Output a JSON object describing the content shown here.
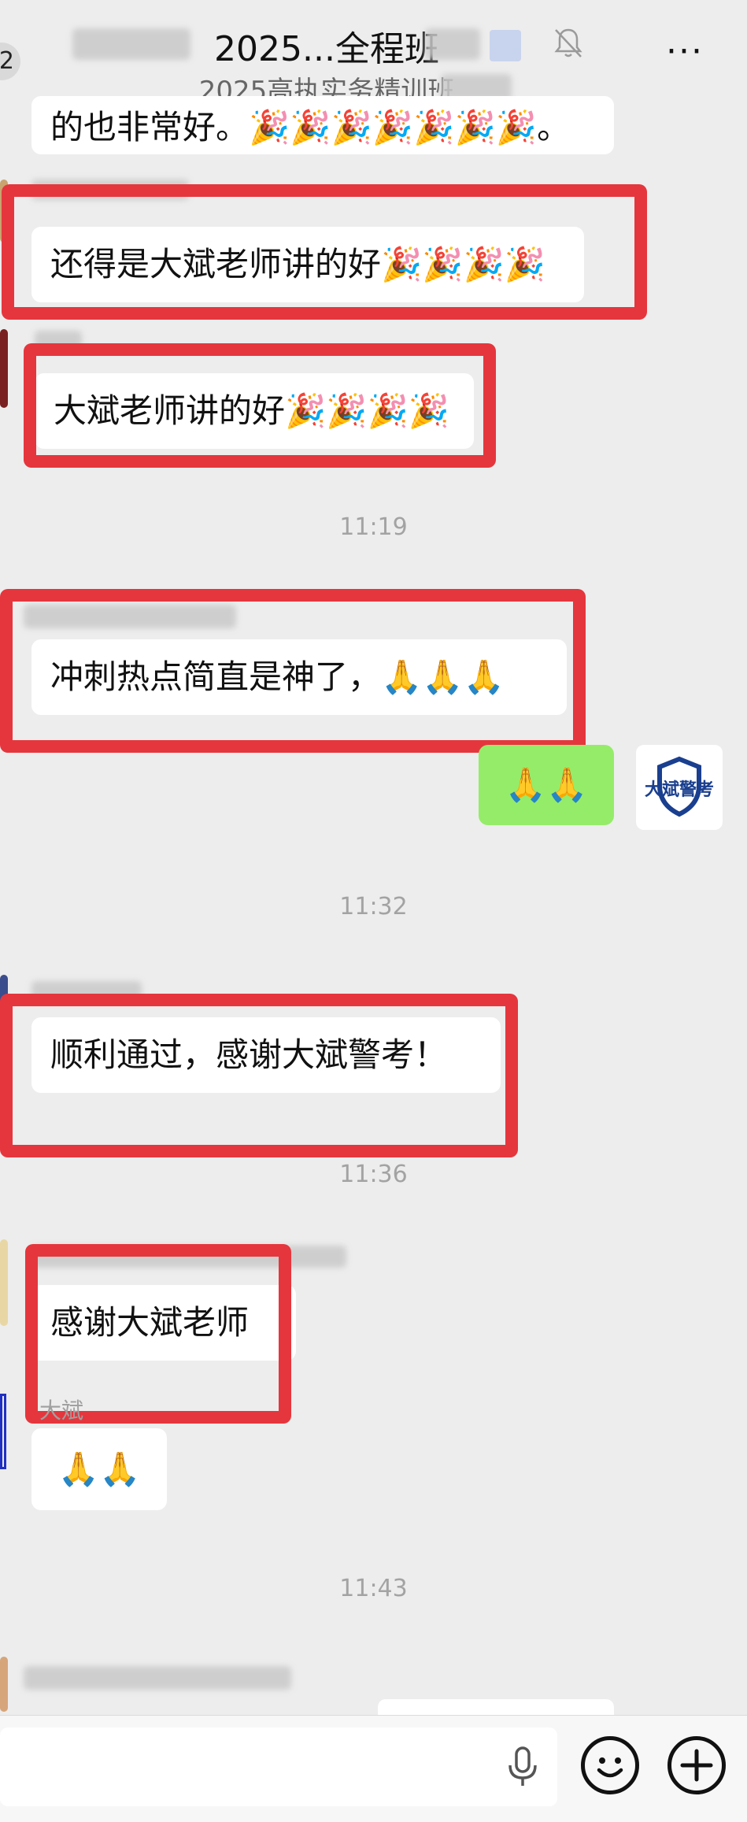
{
  "header": {
    "unread_badge": "2",
    "title": "2025...全程班",
    "subtitle": "2025高执实务精训班",
    "more_label": "···"
  },
  "messages": {
    "top_partial_text": "的也非常好。🎉🎉🎉🎉🎉🎉🎉。",
    "msg1_text": "还得是大斌老师讲的好🎉🎉🎉🎉",
    "msg2_text": "大斌老师讲的好🎉🎉🎉🎉",
    "time1": "11:19",
    "msg3_text": "冲刺热点简直是神了，🙏🙏🙏",
    "msg4_text": "🙏🙏",
    "brand_avatar_text": "大斌警考",
    "time2": "11:32",
    "msg5_text": "顺利通过，感谢大斌警考！",
    "time3": "11:36",
    "msg6_text": "感谢大斌老师",
    "msg7_nick": "大斌",
    "msg7_text": "🙏🙏",
    "time4": "11:43"
  },
  "colors": {
    "highlight": "#e5363d",
    "self_bubble": "#95ec69",
    "background": "#ededed"
  },
  "icons": {
    "mute": "bell-off-icon",
    "voice": "microphone-icon",
    "emoji": "smile-icon",
    "more": "plus-icon"
  }
}
